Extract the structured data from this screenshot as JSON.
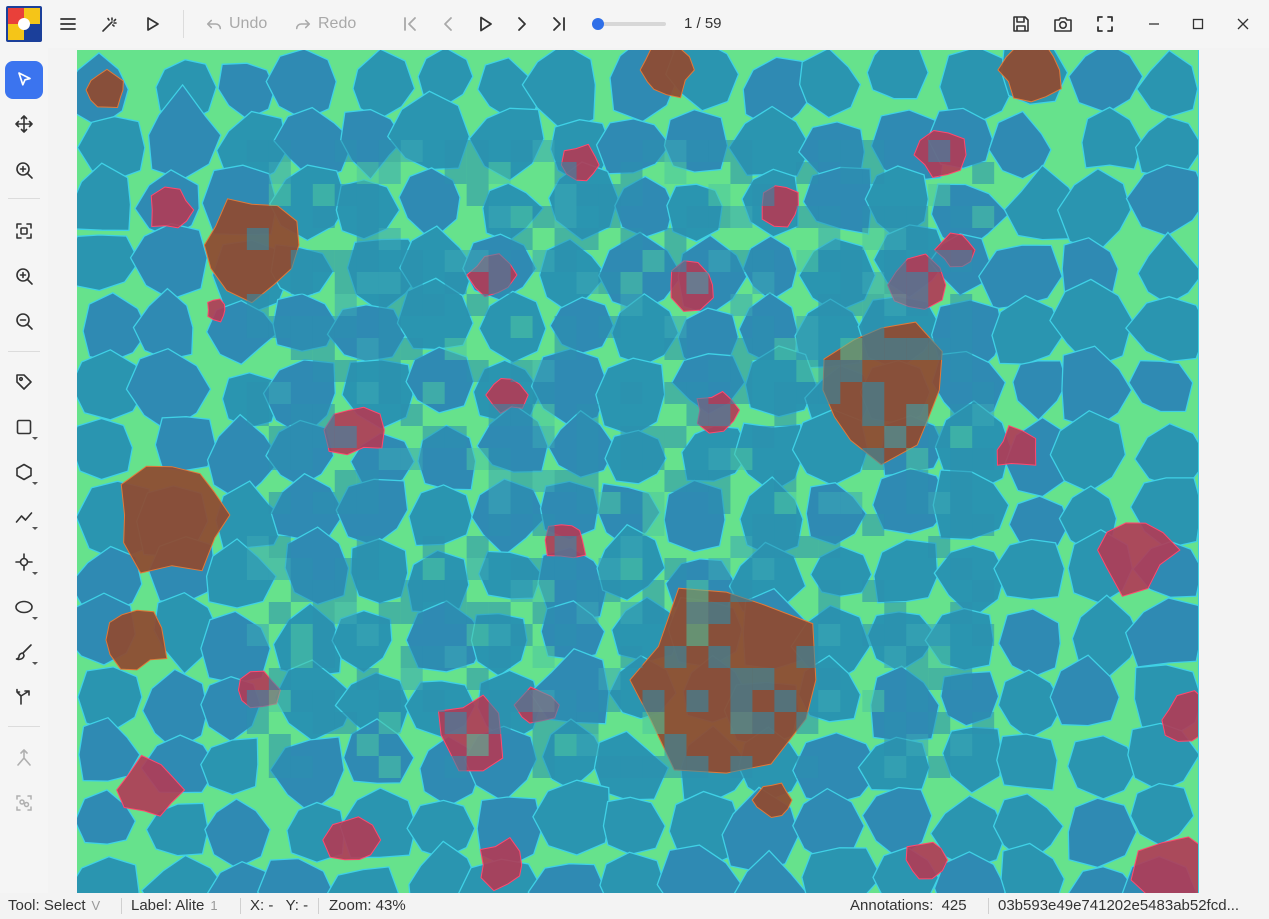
{
  "toolbar": {
    "undo_label": "Undo",
    "redo_label": "Redo",
    "frame_counter": "1 / 59",
    "frame_progress": 0.017
  },
  "left_tools": {
    "select": "select-tool",
    "move": "move-tool",
    "zoom_region": "zoom-region-tool",
    "fit": "fit-to-screen",
    "zoom_in": "zoom-in",
    "zoom_out": "zoom-out",
    "tag": "tag-tool",
    "rectangle": "rectangle-tool",
    "polygon": "polygon-tool",
    "polyline": "polyline-tool",
    "point": "point-tool",
    "ellipse": "ellipse-tool",
    "brush": "brush-tool",
    "ai_polygon": "ai-polygon-tool",
    "skeleton": "skeleton-tool",
    "auto_detect": "auto-detect-tool"
  },
  "status": {
    "tool_label": "Tool: Select",
    "tool_key": "V",
    "label_label": "Label: Alite",
    "label_key": "1",
    "coords": "X: -   Y: -",
    "zoom": "Zoom: 43%",
    "annotations_label": "Annotations:",
    "annotations_count": "425",
    "file_hash": "03b593e49e741202e5483ab52fcd..."
  },
  "colors": {
    "accent": "#3b74ef",
    "canvas_bg": "#2a8fa0",
    "matrix_green": "#5fe08a",
    "alite_blue": "#2f8ab3",
    "belite_red": "#b13a55",
    "pore_brown": "#8f4a30",
    "outline_cyan": "#3fd1e6"
  }
}
